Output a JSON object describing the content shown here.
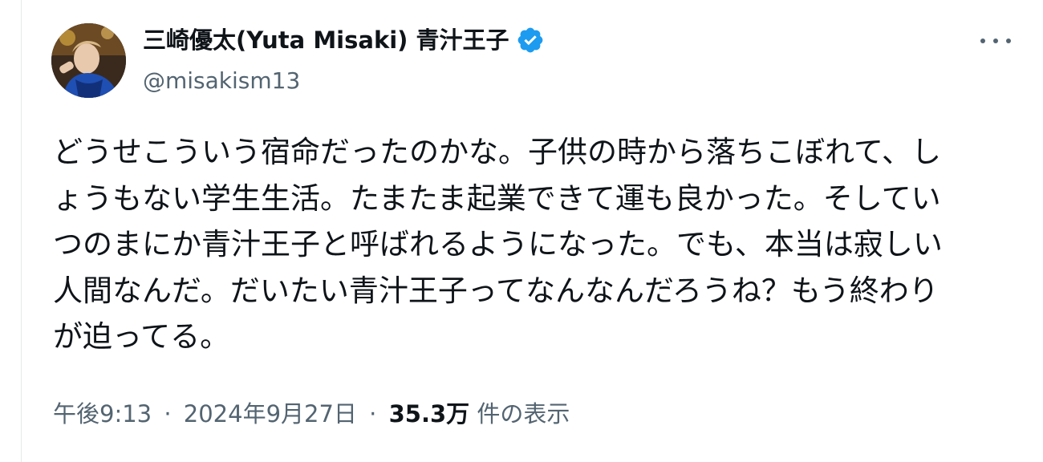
{
  "author": {
    "display_name": "三崎優太(Yuta Misaki) 青汁王子",
    "handle": "@misakism13",
    "verified": true
  },
  "tweet": {
    "lines": [
      "どうせこういう宿命だったのかな。子供の時から落ちこぼれて、し",
      "ょうもない学生生活。たまたま起業できて運も良かった。そしてい",
      "つのまにか青汁王子と呼ばれるようになった。でも、本当は寂しい",
      "人間なんだ。だいたい青汁王子ってなんなんだろうね？もう終わり",
      "が迫ってる。"
    ]
  },
  "meta": {
    "time": "午後9:13",
    "separator": "·",
    "date": "2024年9月27日",
    "views_count": "35.3万",
    "views_label": "件の表示"
  },
  "icons": {
    "verified": "verified-badge-icon",
    "more": "more-options-icon"
  },
  "colors": {
    "text_primary": "#0f1419",
    "text_secondary": "#536471",
    "verified_blue": "#1d9bf0"
  }
}
